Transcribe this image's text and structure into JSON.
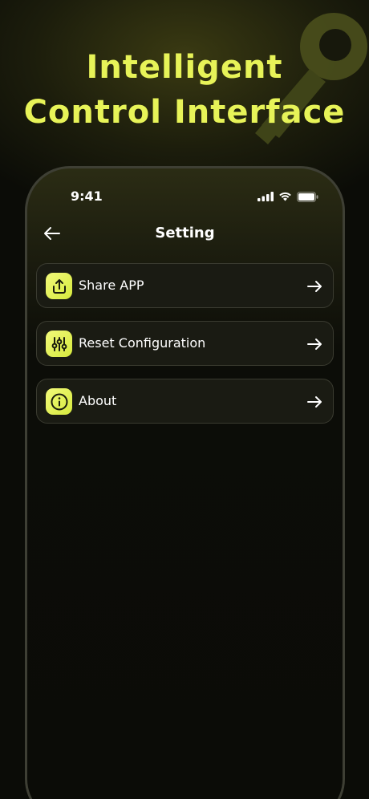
{
  "headline": {
    "line1": "Intelligent",
    "line2": "Control Interface"
  },
  "colors": {
    "accent": "#e7f358",
    "background": "#0b0c07",
    "card": "#1a1b13",
    "card_border": "#3a3b30"
  },
  "status_bar": {
    "time": "9:41",
    "icons": [
      "cellular-signal-icon",
      "wifi-icon",
      "battery-icon"
    ]
  },
  "navbar": {
    "title": "Setting",
    "back_icon": "arrow-left-icon"
  },
  "menu": {
    "items": [
      {
        "label": "Share APP",
        "icon": "share-upload-icon",
        "arrow": "arrow-right-icon"
      },
      {
        "label": "Reset Configuration",
        "icon": "sliders-icon",
        "arrow": "arrow-right-icon"
      },
      {
        "label": "About",
        "icon": "info-icon",
        "arrow": "arrow-right-icon"
      }
    ]
  },
  "decoration": {
    "icon": "key-icon"
  }
}
